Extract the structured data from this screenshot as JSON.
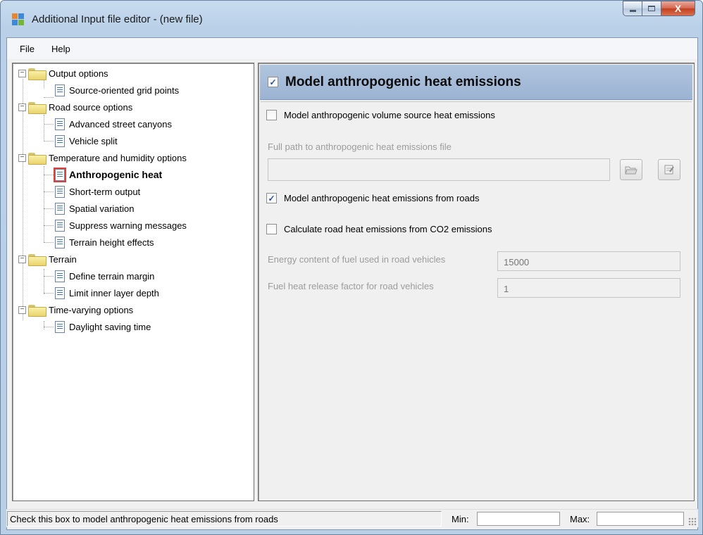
{
  "window": {
    "title": "Additional Input file editor - (new file)",
    "controls": {
      "minimize": "—",
      "maximize": "□",
      "close": "X"
    }
  },
  "menu": [
    "File",
    "Help"
  ],
  "tree": {
    "groups": [
      {
        "label": "Output options",
        "icon": "folder-icon",
        "expanded": true,
        "children": [
          {
            "label": "Source-oriented grid points"
          }
        ]
      },
      {
        "label": "Road source options",
        "icon": "folder-icon",
        "expanded": true,
        "children": [
          {
            "label": "Advanced street canyons"
          },
          {
            "label": "Vehicle split"
          }
        ]
      },
      {
        "label": "Temperature and humidity options",
        "icon": "folder-icon",
        "expanded": true,
        "children": [
          {
            "label": "Anthropogenic heat",
            "selected": true
          },
          {
            "label": "Short-term output"
          },
          {
            "label": "Spatial variation"
          },
          {
            "label": "Suppress warning messages"
          },
          {
            "label": "Terrain height effects"
          }
        ]
      },
      {
        "label": "Terrain",
        "icon": "folder-icon",
        "expanded": true,
        "children": [
          {
            "label": "Define terrain margin"
          },
          {
            "label": "Limit inner layer depth"
          }
        ]
      },
      {
        "label": "Time-varying options",
        "icon": "folder-icon",
        "expanded": true,
        "children": [
          {
            "label": "Daylight saving time"
          }
        ]
      }
    ]
  },
  "panel": {
    "title": "Model anthropogenic heat emissions",
    "title_checked": true,
    "volume_source": {
      "label": "Model anthropogenic volume source heat emissions",
      "checked": false
    },
    "file_path": {
      "label": "Full path to anthropogenic heat emissions file",
      "value": ""
    },
    "roads": {
      "label": "Model anthropogenic heat emissions from roads",
      "checked": true
    },
    "co2": {
      "label": "Calculate road heat emissions from CO2 emissions",
      "checked": false
    },
    "energy_content": {
      "label": "Energy content of fuel used in road vehicles",
      "value": "15000"
    },
    "heat_release": {
      "label": "Fuel heat release factor for road vehicles",
      "value": "1"
    }
  },
  "status": {
    "message": "Check this box to model anthropogenic heat emissions from roads",
    "min_label": "Min:",
    "min_value": "",
    "max_label": "Max:",
    "max_value": ""
  }
}
